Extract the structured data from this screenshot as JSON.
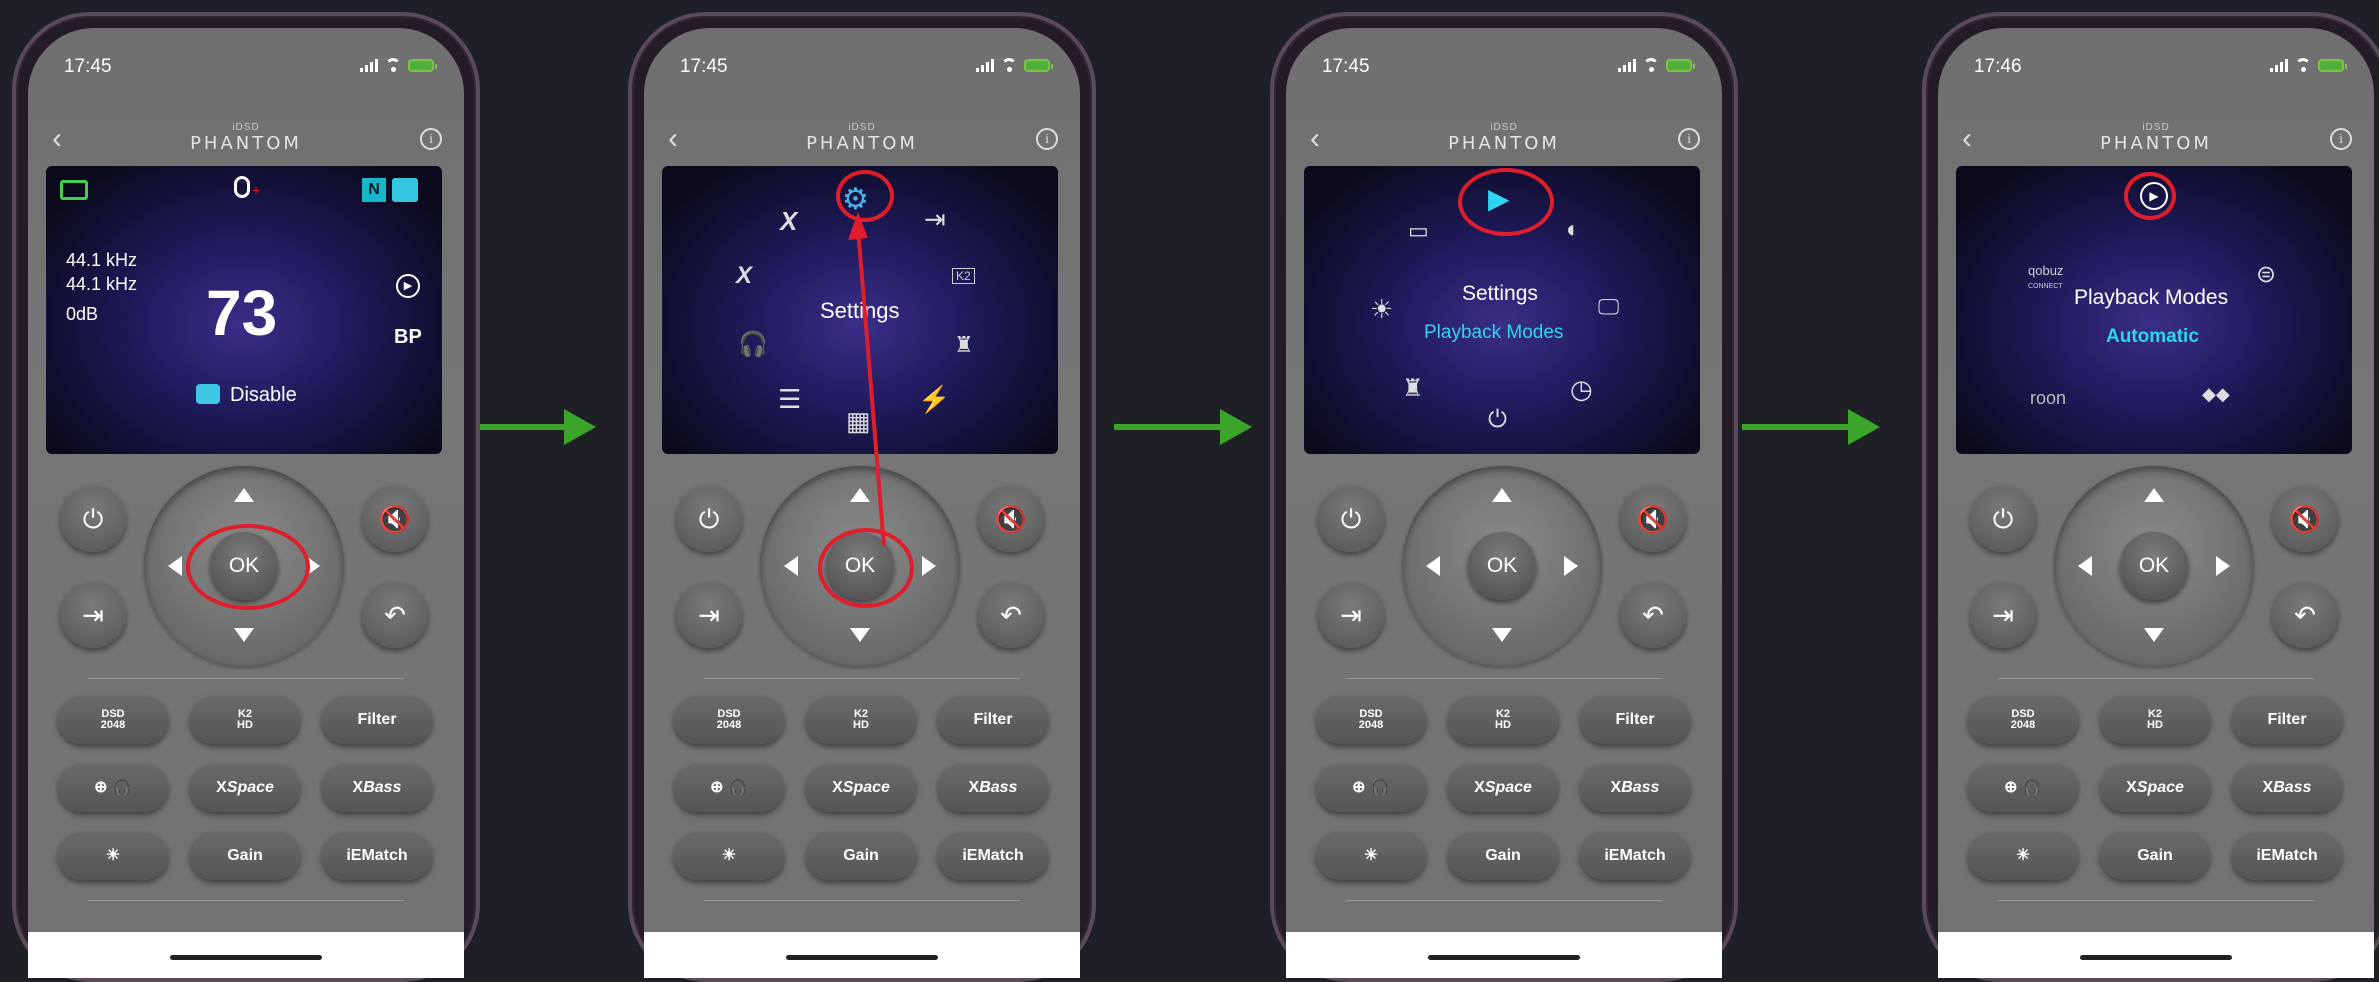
{
  "phones": [
    {
      "time": "17:45",
      "brand_small": "iDSD",
      "brand": "PHANTOM",
      "display": {
        "freq1": "44.1 kHz",
        "freq2": "44.1 kHz",
        "gain": "0dB",
        "volume": "73",
        "filter": "BP",
        "status": "Disable"
      }
    },
    {
      "time": "17:45",
      "brand_small": "iDSD",
      "brand": "PHANTOM",
      "display": {
        "title": "Settings"
      }
    },
    {
      "time": "17:45",
      "brand_small": "iDSD",
      "brand": "PHANTOM",
      "display": {
        "title": "Settings",
        "subtitle": "Playback Modes"
      }
    },
    {
      "time": "17:46",
      "brand_small": "iDSD",
      "brand": "PHANTOM",
      "display": {
        "title": "Playback Modes",
        "subtitle": "Automatic",
        "qobuz_top": "qobuz",
        "qobuz_bottom": "CONNECT",
        "roon": "roon"
      }
    }
  ],
  "controls": {
    "ok": "OK",
    "dsd_top": "DSD",
    "dsd_bottom": "2048",
    "k2_top": "K2",
    "k2_bottom": "HD",
    "filter": "Filter",
    "xspace_x": "X",
    "xspace": "Space",
    "xbass_x": "X",
    "xbass": "Bass",
    "gain": "Gain",
    "iematch": "iEMatch"
  },
  "colors": {
    "highlight_ring": "#e01d2a",
    "flow_arrow": "#3aa52a",
    "subtitle_cyan": "#2fd4f0",
    "gear_blue": "#4ab4e8"
  },
  "icons": {
    "back": "chevron-left-icon",
    "info": "info-icon",
    "power": "power-icon",
    "mute": "speaker-mute-icon",
    "input": "input-icon",
    "return": "return-icon",
    "brightness": "sun-icon"
  }
}
